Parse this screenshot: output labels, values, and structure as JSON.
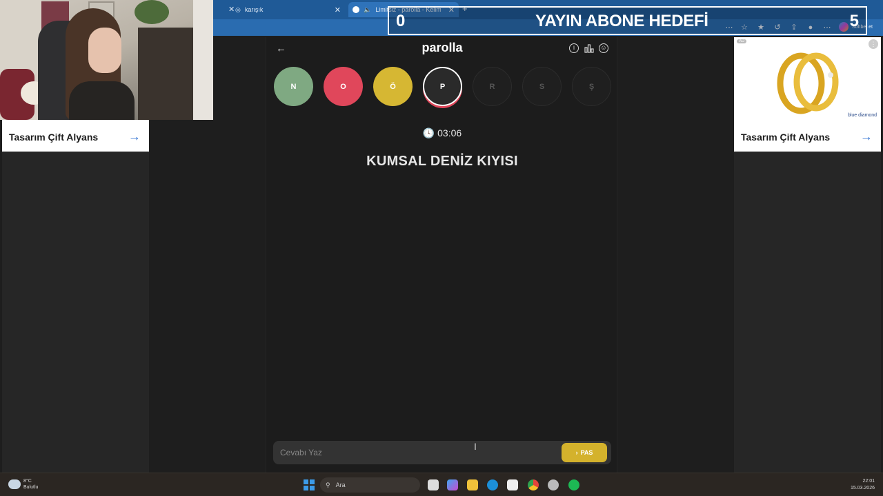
{
  "browser": {
    "tabs": [
      {
        "label": "karışık"
      },
      {
        "label": "Limitsiz - parolla - Kelime oyunu"
      }
    ],
    "copilot_label": "Sohbet et"
  },
  "overlay": {
    "current": "0",
    "title": "YAYIN ABONE HEDEFİ",
    "goal": "5"
  },
  "ads": {
    "left_title": "Tasarım Çift Alyans",
    "right_title": "Tasarım Çift Alyans",
    "right_badge": "AD",
    "brand": "blue diamond"
  },
  "game": {
    "logo": "parolla",
    "letters": [
      {
        "letter": "N",
        "state": "correct",
        "color": "#7fa982"
      },
      {
        "letter": "O",
        "state": "wrong",
        "color": "#e0475b"
      },
      {
        "letter": "Ö",
        "state": "passed",
        "color": "#d6b733"
      },
      {
        "letter": "P",
        "state": "active",
        "color": "#2a2a2a"
      },
      {
        "letter": "R",
        "state": "pending",
        "color": "#1f1f1f"
      },
      {
        "letter": "S",
        "state": "pending",
        "color": "#1f1f1f"
      },
      {
        "letter": "Ş",
        "state": "pending",
        "color": "#1f1f1f"
      }
    ],
    "timer": "03:06",
    "clue": "KUMSAL DENİZ KIYISI",
    "answer_placeholder": "Cevabı Yaz",
    "pass_label": "PAS"
  },
  "taskbar": {
    "temperature": "8°C",
    "weather": "Bulutlu",
    "search_label": "Ara",
    "time": "22:01",
    "date": "15.03.2026"
  },
  "colors": {
    "accent_blue": "#2a6cb0",
    "pass_button": "#d4b22c",
    "ad_arrow": "#2d6fd1"
  }
}
